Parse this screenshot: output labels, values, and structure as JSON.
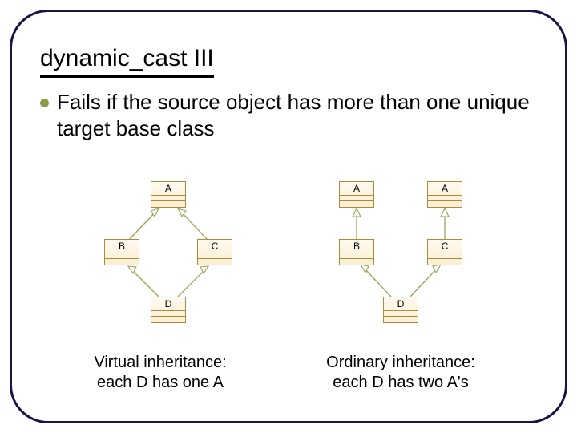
{
  "title": "dynamic_cast III",
  "bullet": "Fails if the source object has more than one unique target base class",
  "diagrams": {
    "left": {
      "boxes": {
        "A": "A",
        "B": "B",
        "C": "C",
        "D": "D"
      },
      "caption_line1": "Virtual inheritance:",
      "caption_line2": "each D has one A"
    },
    "right": {
      "boxes": {
        "A1": "A",
        "A2": "A",
        "B": "B",
        "C": "C",
        "D": "D"
      },
      "caption_line1": "Ordinary inheritance:",
      "caption_line2": "each D has two A's"
    }
  }
}
